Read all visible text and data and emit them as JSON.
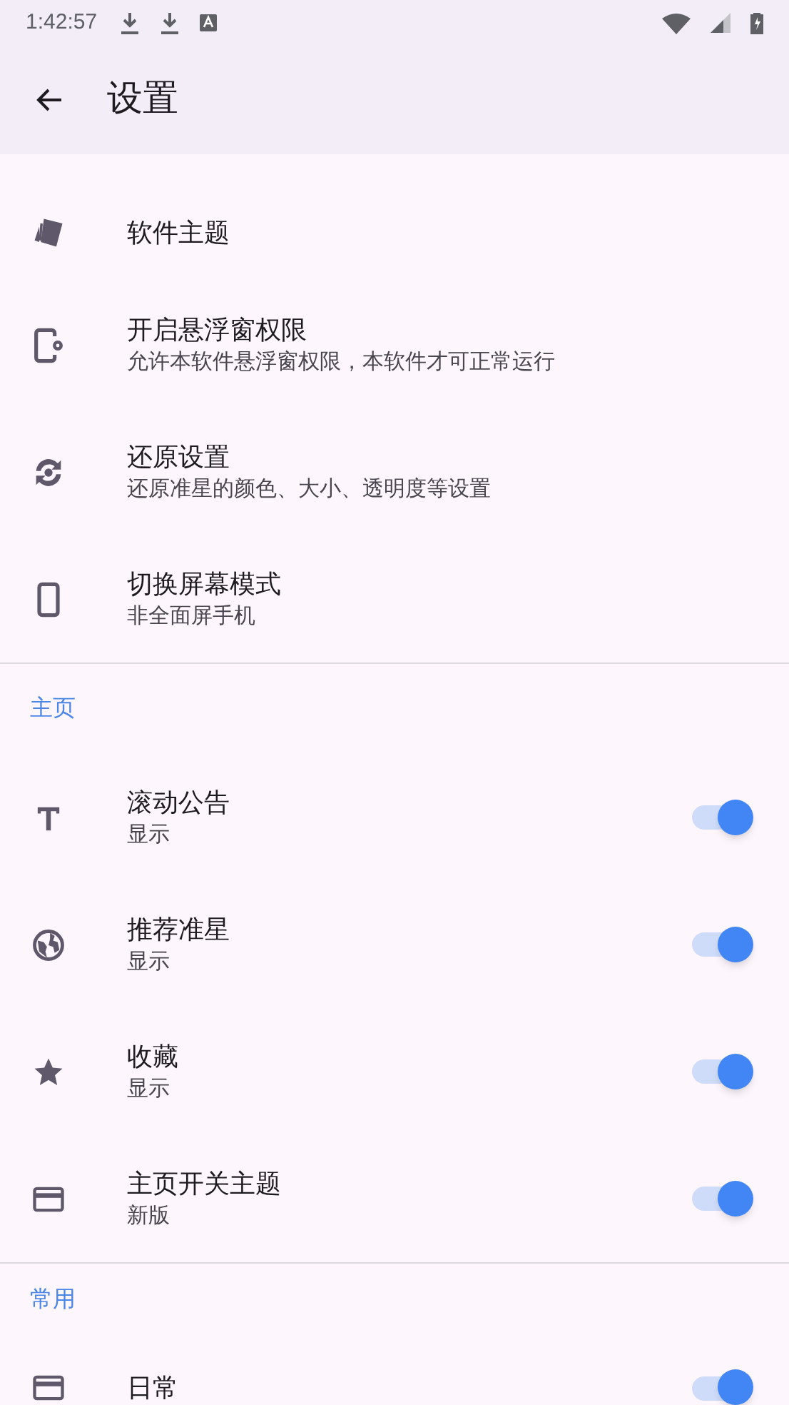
{
  "status_bar": {
    "time": "1:42:57"
  },
  "app_bar": {
    "title": "设置"
  },
  "general_items": [
    {
      "kind": "cards",
      "title": "软件主题"
    },
    {
      "kind": "phone-gear",
      "title": "开启悬浮窗权限",
      "subtitle": "允许本软件悬浮窗权限，本软件才可正常运行"
    },
    {
      "kind": "restore",
      "title": "还原设置",
      "subtitle": "还原准星的颜色、大小、透明度等设置"
    },
    {
      "kind": "phone",
      "title": "切换屏幕模式",
      "subtitle": "非全面屏手机"
    }
  ],
  "sections": [
    {
      "header": "主页",
      "items": [
        {
          "kind": "text",
          "title": "滚动公告",
          "subtitle": "显示",
          "on": true
        },
        {
          "kind": "globe",
          "title": "推荐准星",
          "subtitle": "显示",
          "on": true
        },
        {
          "kind": "star",
          "title": "收藏",
          "subtitle": "显示",
          "on": true
        },
        {
          "kind": "card",
          "title": "主页开关主题",
          "subtitle": "新版",
          "on": true
        }
      ]
    },
    {
      "header": "常用",
      "items": [
        {
          "kind": "card",
          "title": "日常",
          "on": true
        }
      ]
    }
  ]
}
